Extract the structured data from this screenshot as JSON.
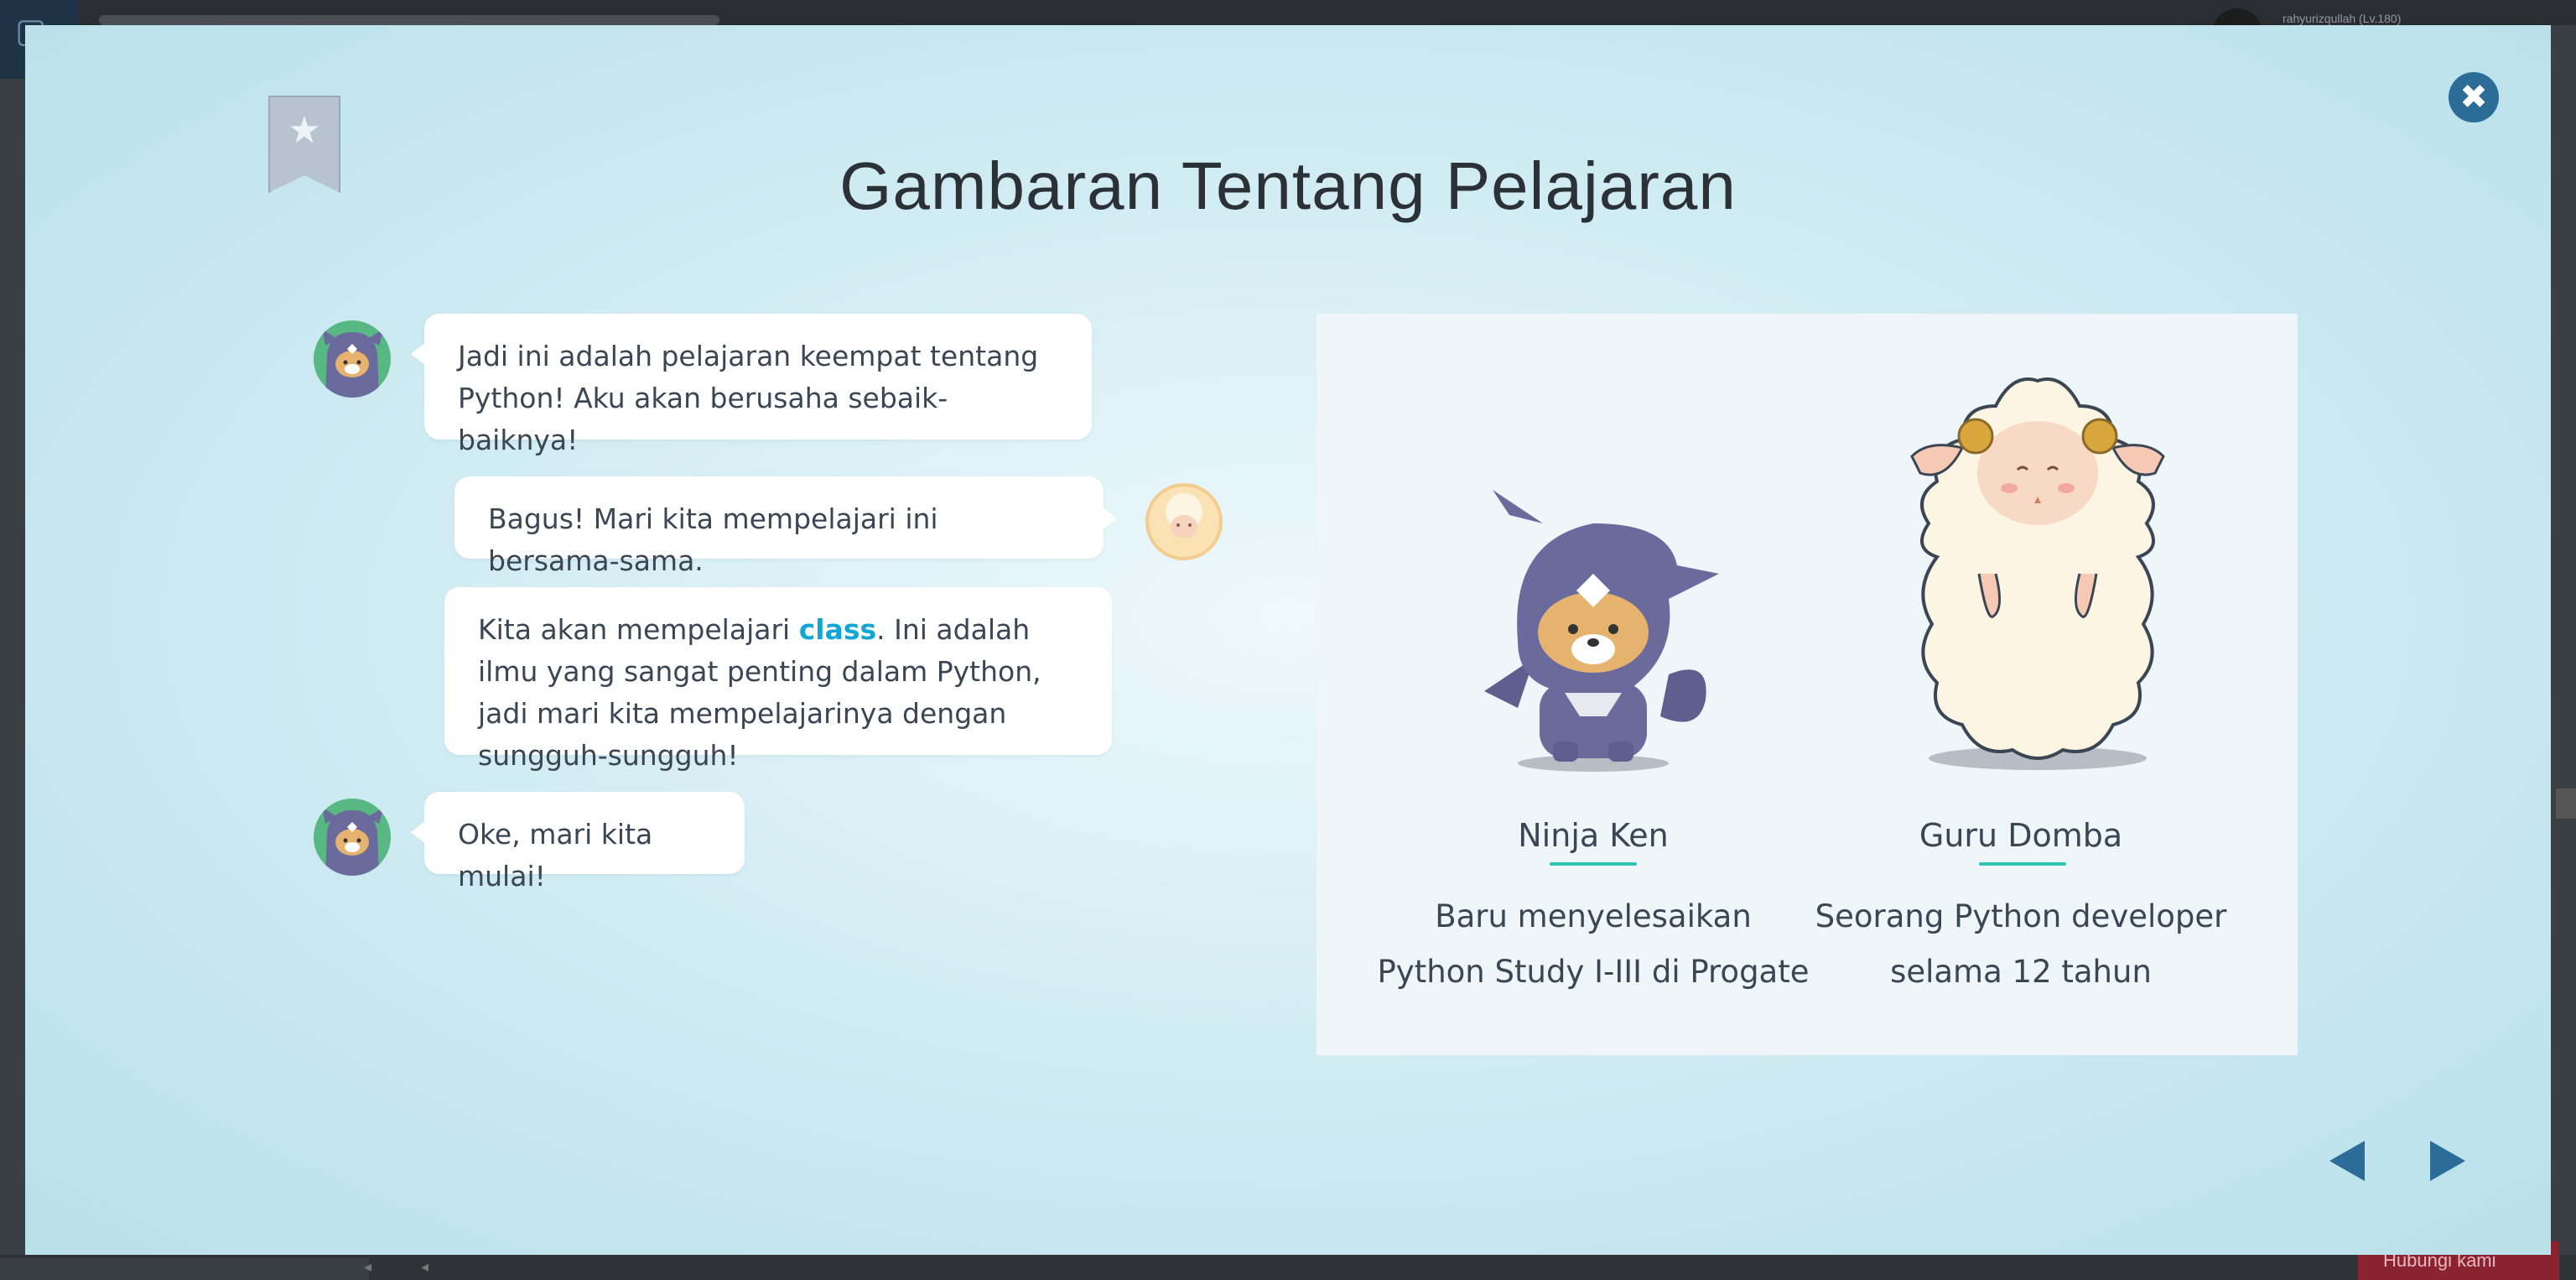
{
  "backdrop": {
    "username": "rahyurizqullah (Lv.180)",
    "cta_label": "Hubungi kami"
  },
  "modal": {
    "title": "Gambaran Tentang Pelajaran",
    "close_icon": "close-icon",
    "bookmark_icon": "bookmark-star-icon"
  },
  "chat": [
    {
      "speaker": "ken",
      "text": "Jadi ini adalah pelajaran keempat tentang Python! Aku akan berusaha sebaik-baiknya!"
    },
    {
      "speaker": "sheep",
      "text": "Bagus! Mari kita mempelajari ini bersama-sama."
    },
    {
      "speaker": "sheep",
      "text_before": "Kita akan mempelajari ",
      "keyword": "class",
      "text_after": ". Ini adalah ilmu yang sangat penting dalam Python, jadi mari kita mempelajarinya dengan sungguh-sungguh!"
    },
    {
      "speaker": "ken",
      "text": "Oke, mari kita mulai!"
    }
  ],
  "characters": [
    {
      "name": "Ninja Ken",
      "desc_line1": "Baru menyelesaikan",
      "desc_line2": "Python Study I-III di Progate"
    },
    {
      "name": "Guru Domba",
      "desc_line1": "Seorang Python developer",
      "desc_line2": "selama 12 tahun"
    }
  ],
  "colors": {
    "accent": "#2c6d97",
    "keyword": "#12a5d6",
    "underline": "#2fc3b2",
    "ken_purple": "#6b6a9c",
    "sheep_wool": "#fdf5e3"
  },
  "nav": {
    "prev_icon": "triangle-left-icon",
    "next_icon": "triangle-right-icon"
  }
}
